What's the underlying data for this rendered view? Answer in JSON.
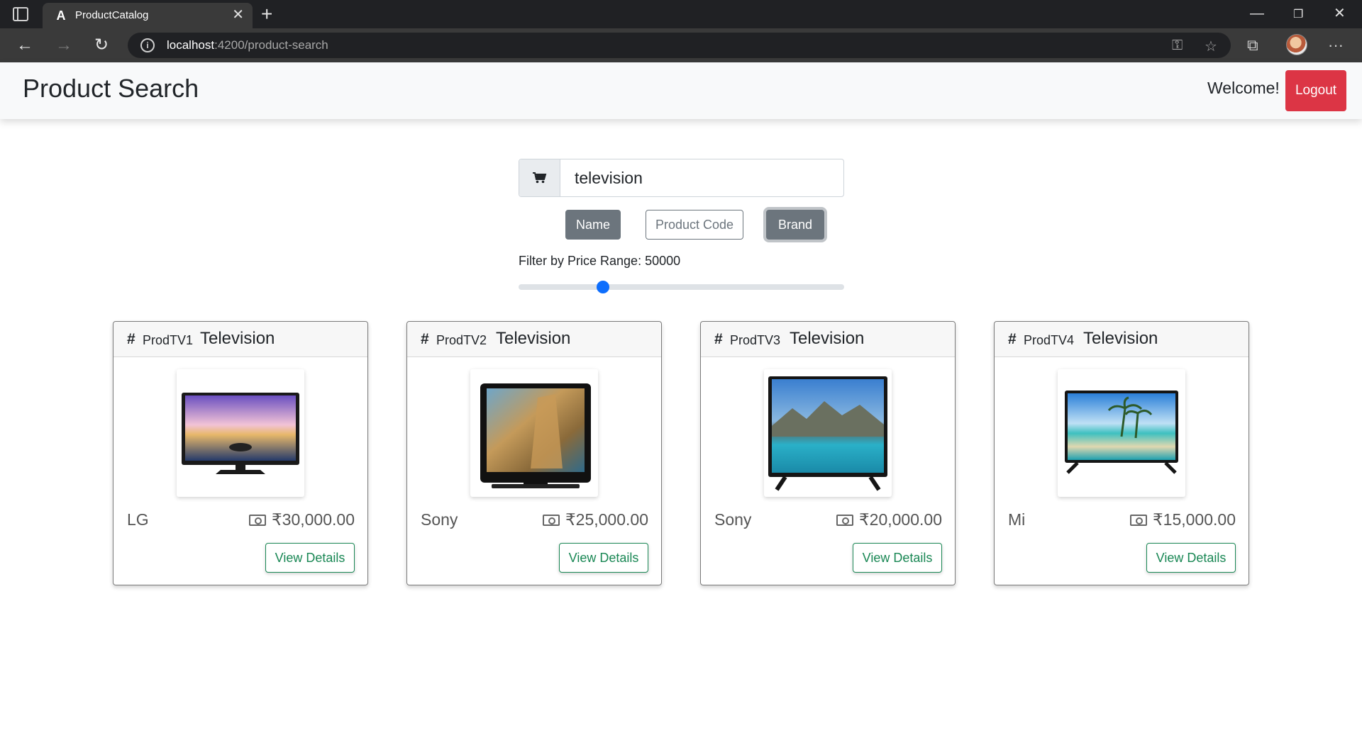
{
  "browser": {
    "tab_title": "ProductCatalog",
    "favicon": "A",
    "url_host": "localhost",
    "url_path": ":4200/product-search",
    "icons": [
      "tab-actions-icon",
      "close-icon",
      "plus-icon",
      "minimize-icon",
      "restore-icon",
      "window-close-icon",
      "back-icon",
      "forward-icon",
      "reload-icon",
      "info-icon",
      "key-icon",
      "favorite-icon",
      "collections-icon",
      "profile-avatar",
      "more-icon"
    ]
  },
  "header": {
    "title": "Product Search",
    "welcome": "Welcome!",
    "logout_label": "Logout"
  },
  "search": {
    "value": "television",
    "icon": "cart-icon",
    "filters": [
      {
        "label": "Name",
        "active": true
      },
      {
        "label": "Product Code",
        "active": false
      },
      {
        "label": "Brand",
        "active": true
      }
    ]
  },
  "price_filter": {
    "label": "Filter by Price Range: 50000",
    "value": 50000,
    "position_fraction": 0.26
  },
  "products": [
    {
      "code": "ProdTV1",
      "name": "Television",
      "brand": "LG",
      "price": "₹30,000.00",
      "action": "View Details"
    },
    {
      "code": "ProdTV2",
      "name": "Television",
      "brand": "Sony",
      "price": "₹25,000.00",
      "action": "View Details"
    },
    {
      "code": "ProdTV3",
      "name": "Television",
      "brand": "Sony",
      "price": "₹20,000.00",
      "action": "View Details"
    },
    {
      "code": "ProdTV4",
      "name": "Television",
      "brand": "Mi",
      "price": "₹15,000.00",
      "action": "View Details"
    }
  ],
  "colors": {
    "logout": "#dc3545",
    "secondary": "#6c757d",
    "success": "#198754",
    "slider_thumb": "#0d6efd"
  }
}
